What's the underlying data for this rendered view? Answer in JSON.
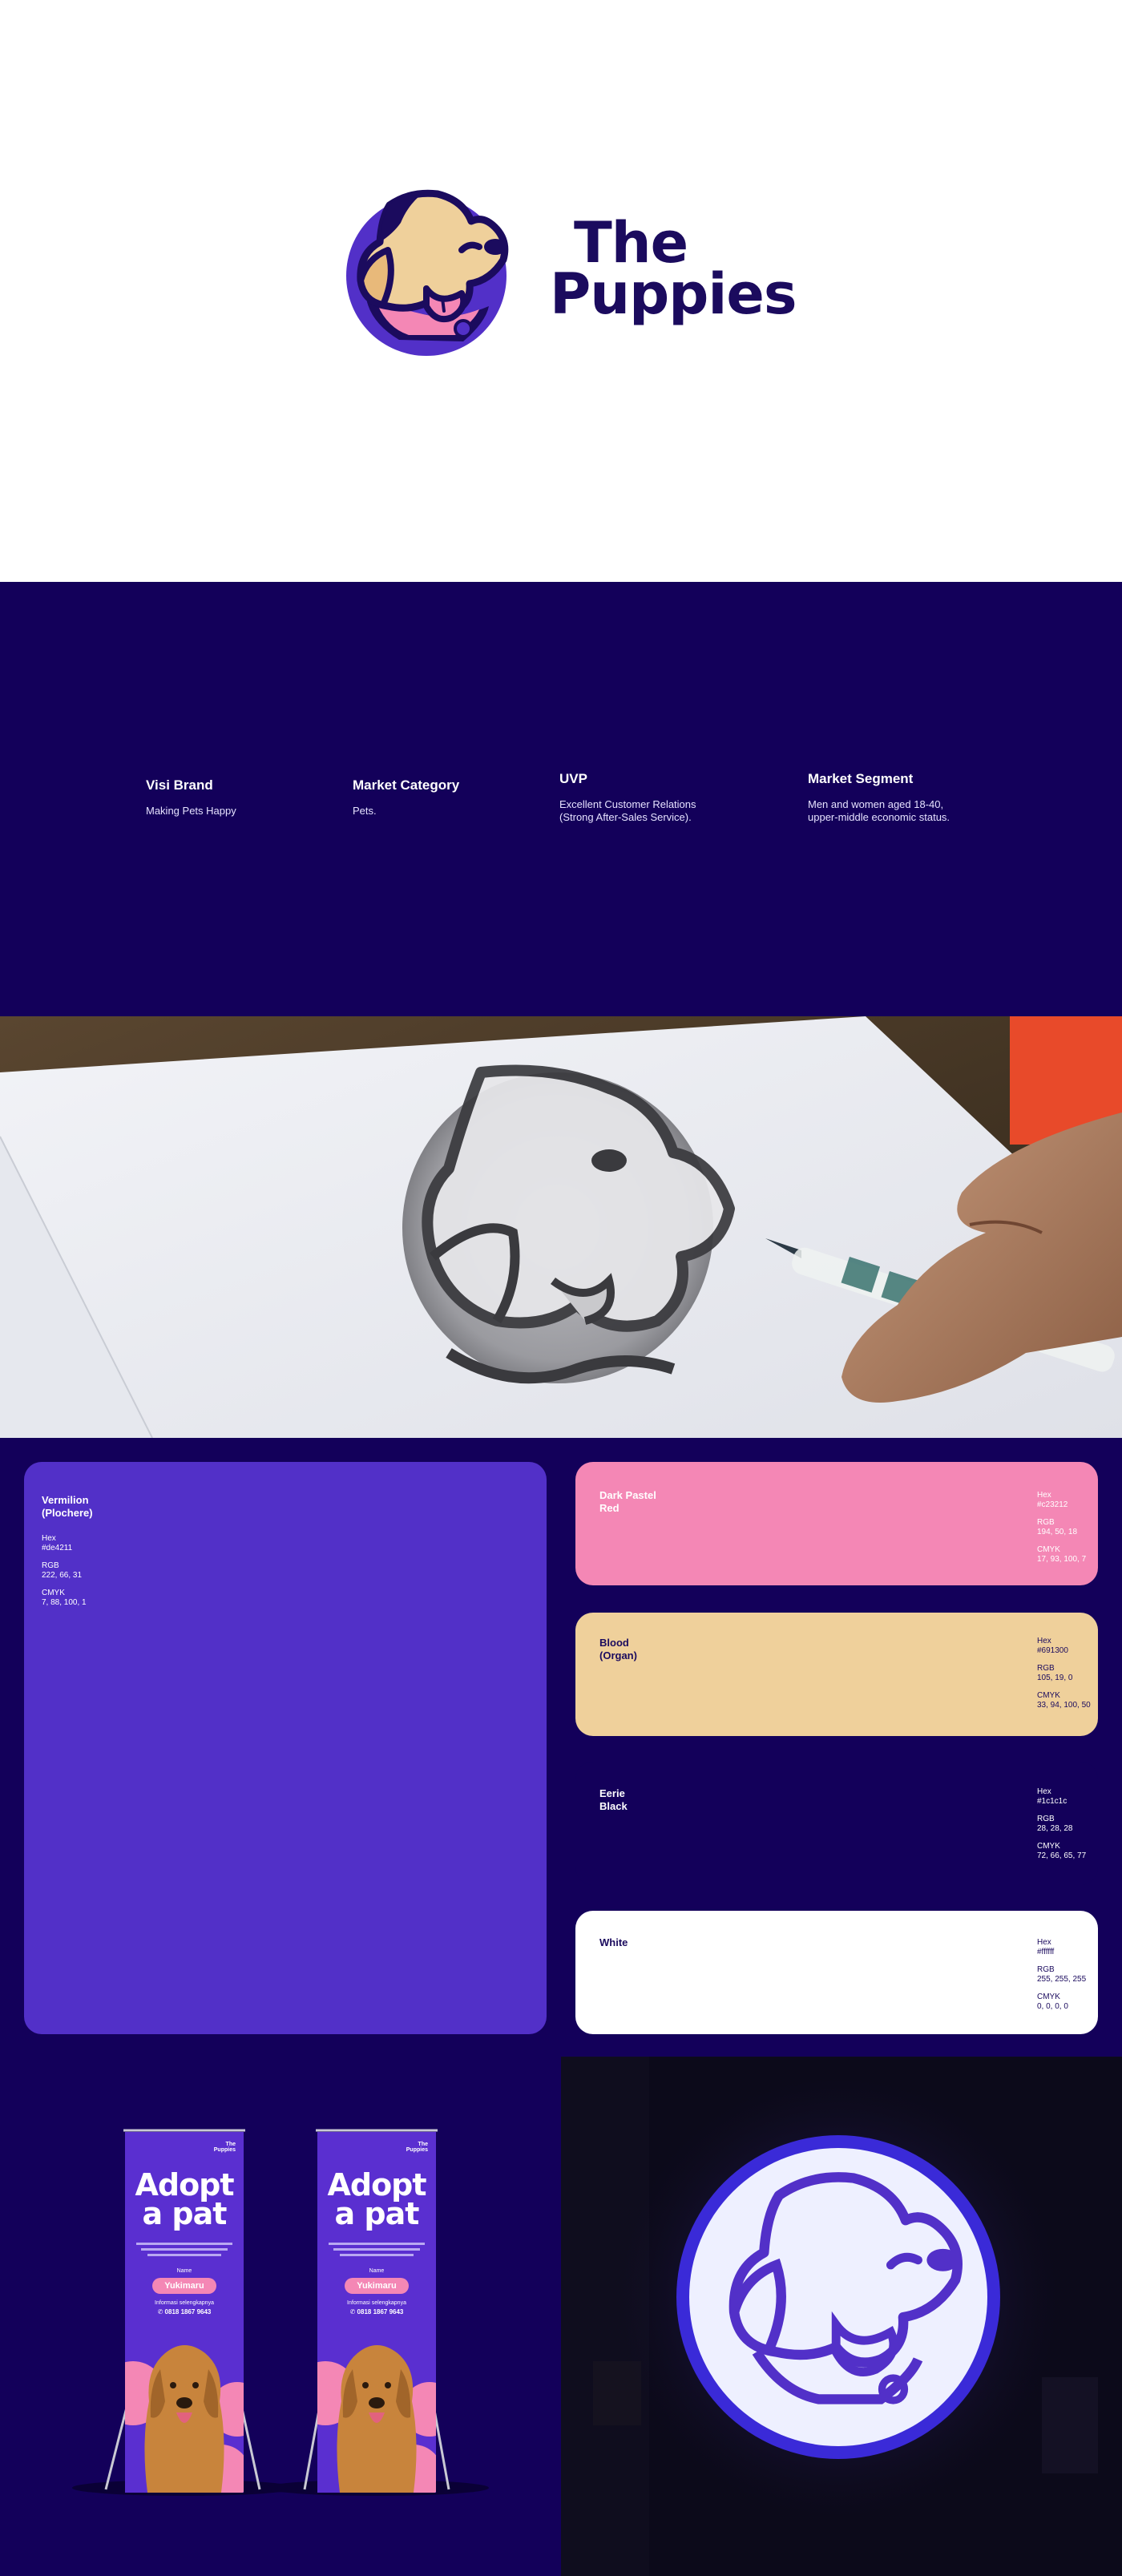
{
  "hero": {
    "wordmark_line1": "The",
    "wordmark_line2": "Puppies"
  },
  "brand_info": [
    {
      "title": "Visi Brand",
      "text": "Making Pets Happy"
    },
    {
      "title": "Market Category",
      "text": "Pets."
    },
    {
      "title": "UVP",
      "text": "Excellent Customer Relations\n(Strong After-Sales Service)."
    },
    {
      "title": "Market Segment",
      "text": "Men and women aged 18-40,\nupper-middle economic status."
    }
  ],
  "palette": [
    {
      "name": "Vermilion\n(Plochere)",
      "hex_label": "Hex",
      "hex": "#de4211",
      "rgb_label": "RGB",
      "rgb": "222, 66, 31",
      "cmyk_label": "CMYK",
      "cmyk": "7, 88, 100, 1",
      "fill": "#5230c8",
      "text_color": "#ffffff"
    },
    {
      "name": "Dark Pastel\nRed",
      "hex_label": "Hex",
      "hex": "#c23212",
      "rgb_label": "RGB",
      "rgb": "194, 50, 18",
      "cmyk_label": "CMYK",
      "cmyk": "17, 93, 100, 7",
      "fill": "#f487b5",
      "text_color": "#ffffff"
    },
    {
      "name": "Blood\n(Organ)",
      "hex_label": "Hex",
      "hex": "#691300",
      "rgb_label": "RGB",
      "rgb": "105, 19, 0",
      "cmyk_label": "CMYK",
      "cmyk": "33, 94, 100, 50",
      "fill": "#efd09b",
      "text_color": "#1b0b5e"
    },
    {
      "name": "Eerie\nBlack",
      "hex_label": "Hex",
      "hex": "#1c1c1c",
      "rgb_label": "RGB",
      "rgb": "28, 28, 28",
      "cmyk_label": "CMYK",
      "cmyk": "72, 66, 65, 77",
      "fill": "#13005a",
      "text_color": "#ffffff"
    },
    {
      "name": "White",
      "hex_label": "Hex",
      "hex": "#ffffff",
      "rgb_label": "RGB",
      "rgb": "255, 255, 255",
      "cmyk_label": "CMYK",
      "cmyk": "0, 0, 0, 0",
      "fill": "#ffffff",
      "text_color": "#1b0b5e"
    }
  ],
  "banner": {
    "brand_small": "The\nPuppies",
    "headline": "Adopt\na pat",
    "name_label": "Name",
    "pet_name": "Yukimaru",
    "info_label": "Informasi selengkapnya",
    "phone": "0818 1867 9643"
  },
  "colors": {
    "navy": "#13005a",
    "violet": "#5230c8",
    "pink": "#f487b5",
    "cream": "#efd09b",
    "dark_text": "#1b0b5e"
  },
  "icons": [
    "puppy-logo-icon",
    "whatsapp-icon",
    "pencil-icon"
  ]
}
